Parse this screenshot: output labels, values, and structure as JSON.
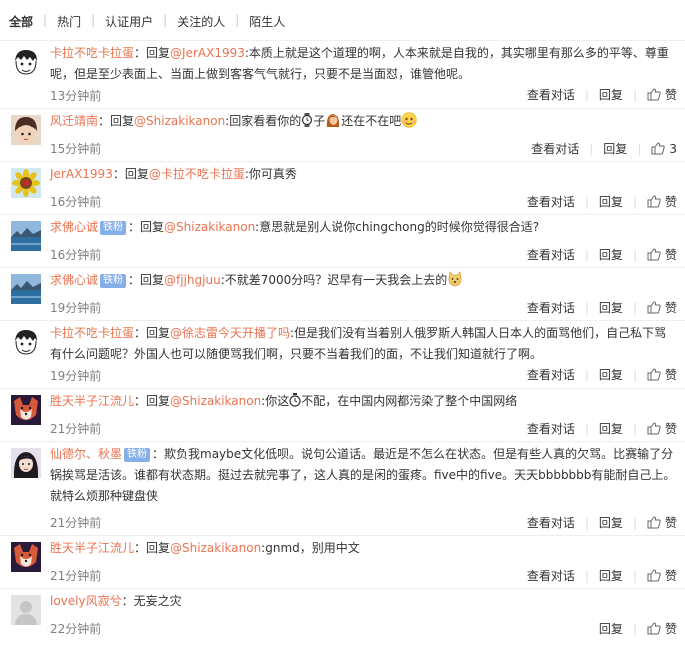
{
  "tabs": [
    "全部",
    "热门",
    "认证用户",
    "关注的人",
    "陌生人"
  ],
  "action_labels": {
    "view_conversation": "查看对话",
    "reply": "回复",
    "like": "赞"
  },
  "comments": [
    {
      "user": "卡拉不吃卡拉蛋",
      "reply_prefix": "：回复",
      "mention": "@JerAX1993",
      "text": ":本质上就是这个道理的啊，人本来就是自我的，其实哪里有那么多的平等、尊重呢，但是至少表面上、当面上做到客客气气就行，只要不是当面怼，谁管他呢。",
      "time": "13分钟前",
      "likes": "赞"
    },
    {
      "user": "风迁靖南",
      "reply_prefix": "：回复",
      "mention": "@Shizakikanon",
      "text_a": ":回家看看你的",
      "text_b": "子",
      "text_c": "还在不在吧",
      "time": "15分钟前",
      "likes": "3"
    },
    {
      "user": "JerAX1993",
      "reply_prefix": "：回复",
      "mention": "@卡拉不吃卡拉蛋",
      "text": ":你可真秀",
      "time": "16分钟前",
      "likes": "赞"
    },
    {
      "user": "求佛心诚",
      "badge": "铁粉",
      "reply_prefix": "：回复",
      "mention": "@Shizakikanon",
      "text": ":意思就是别人说你chingchong的时候你觉得很合适?",
      "time": "16分钟前",
      "likes": "赞"
    },
    {
      "user": "求佛心诚",
      "badge": "铁粉",
      "reply_prefix": "：回复",
      "mention": "@fjjhgjuu",
      "text": ":不就差7000分吗？迟早有一天我会上去的",
      "time": "19分钟前",
      "likes": "赞"
    },
    {
      "user": "卡拉不吃卡拉蛋",
      "reply_prefix": "：回复",
      "mention": "@徐志雷今天开播了吗",
      "text": ":但是我们没有当着别人俄罗斯人韩国人日本人的面骂他们，自己私下骂有什么问题呢？外国人也可以随便骂我们啊，只要不当着我们的面，不让我们知道就行了啊。",
      "time": "19分钟前",
      "likes": "赞"
    },
    {
      "user": "胜天半子江流儿",
      "reply_prefix": "：回复",
      "mention": "@Shizakikanon",
      "text_a": ":你这",
      "text_b": "不配，在中国内网都污染了整个中国网络",
      "time": "21分钟前",
      "likes": "赞"
    },
    {
      "user": "仙德尔、秋墨",
      "badge": "铁粉",
      "text": "：欺负我maybe文化低呗。说句公道话。最近是不怎么在状态。但是有些人真的欠骂。比赛输了分锅挨骂是活该。谁都有状态期。挺过去就完事了，这人真的是闲的蛋疼。five中的five。天天bbbbbbb有能耐自己上。就特么烦那种键盘侠",
      "time": "21分钟前",
      "likes": "赞"
    },
    {
      "user": "胜天半子江流儿",
      "reply_prefix": "：回复",
      "mention": "@Shizakikanon",
      "text": ":gnmd，别用中文",
      "time": "21分钟前",
      "likes": "赞"
    },
    {
      "user": "lovely风寂兮",
      "text": "：无妄之灾",
      "time": "22分钟前",
      "likes": "赞"
    }
  ]
}
